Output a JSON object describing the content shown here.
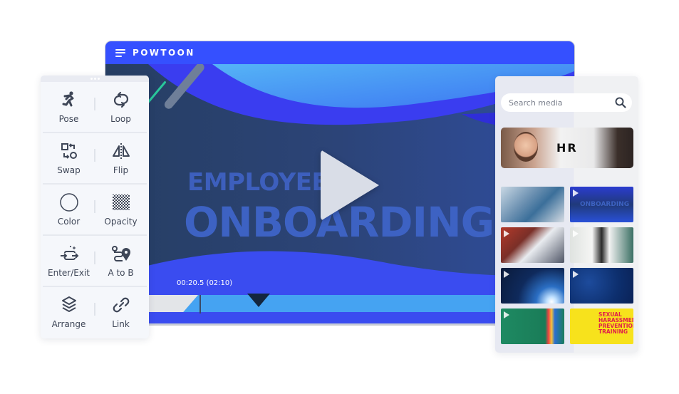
{
  "app": {
    "brand": "POWTOON"
  },
  "video": {
    "title_line1": "EMPLOYEE",
    "title_line2": "ONBOARDING",
    "timecode": "00:20.5 (02:10)",
    "progress_fraction": 0.158
  },
  "tools": {
    "rows": [
      [
        {
          "label": "Pose",
          "icon": "pose-icon"
        },
        {
          "label": "Loop",
          "icon": "loop-icon"
        }
      ],
      [
        {
          "label": "Swap",
          "icon": "swap-icon"
        },
        {
          "label": "Flip",
          "icon": "flip-icon"
        }
      ],
      [
        {
          "label": "Color",
          "icon": "color-icon"
        },
        {
          "label": "Opacity",
          "icon": "opacity-icon"
        }
      ],
      [
        {
          "label": "Enter/Exit",
          "icon": "enter-exit-icon"
        },
        {
          "label": "A to B",
          "icon": "a-to-b-icon"
        }
      ],
      [
        {
          "label": "Arrange",
          "icon": "arrange-icon"
        },
        {
          "label": "Link",
          "icon": "link-icon"
        }
      ]
    ]
  },
  "media": {
    "search_placeholder": "Search media",
    "featured_label": "HR",
    "thumbs": [
      {
        "name": "team-meeting"
      },
      {
        "name": "employee-onboarding",
        "text": "ONBOARDING"
      },
      {
        "name": "desk-laptops"
      },
      {
        "name": "smiling-woman"
      },
      {
        "name": "earth-space"
      },
      {
        "name": "starry-sky"
      },
      {
        "name": "pencils-books"
      },
      {
        "name": "harassment-training",
        "text": "SEXUAL HARASSMENT PREVENTION TRAINING"
      }
    ]
  },
  "colors": {
    "brand_blue": "#3550ff",
    "track": "#45a3f2",
    "panel_bg": "#f5f7fb"
  }
}
